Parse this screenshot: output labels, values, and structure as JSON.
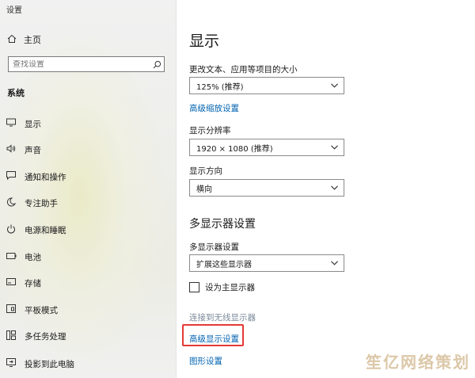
{
  "window": {
    "title": "设置"
  },
  "sidebar": {
    "home_label": "主页",
    "search_placeholder": "查找设置",
    "section_label": "系统",
    "items": [
      {
        "label": "显示",
        "icon": "monitor-icon"
      },
      {
        "label": "声音",
        "icon": "speaker-icon"
      },
      {
        "label": "通知和操作",
        "icon": "notification-icon"
      },
      {
        "label": "专注助手",
        "icon": "moon-icon"
      },
      {
        "label": "电源和睡眠",
        "icon": "power-icon"
      },
      {
        "label": "电池",
        "icon": "battery-icon"
      },
      {
        "label": "存储",
        "icon": "storage-icon"
      },
      {
        "label": "平板模式",
        "icon": "tablet-icon"
      },
      {
        "label": "多任务处理",
        "icon": "multitask-icon"
      },
      {
        "label": "投影到此电脑",
        "icon": "project-icon"
      }
    ]
  },
  "main": {
    "title": "显示",
    "scale": {
      "label": "更改文本、应用等项目的大小",
      "value": "125% (推荐)"
    },
    "advanced_scaling_link": "高级缩放设置",
    "resolution": {
      "label": "显示分辨率",
      "value": "1920 × 1080 (推荐)"
    },
    "orientation": {
      "label": "显示方向",
      "value": "横向"
    },
    "multi_display": {
      "heading": "多显示器设置",
      "label": "多显示器设置",
      "value": "扩展这些显示器",
      "checkbox_label": "设为主显示器",
      "checkbox_checked": false
    },
    "wireless_link": "连接到无线显示器",
    "advanced_display_link": "高级显示设置",
    "graphics_link": "图形设置"
  },
  "watermark": "笙亿网络策划",
  "colors": {
    "link": "#0063b1",
    "highlight": "#e53935"
  }
}
